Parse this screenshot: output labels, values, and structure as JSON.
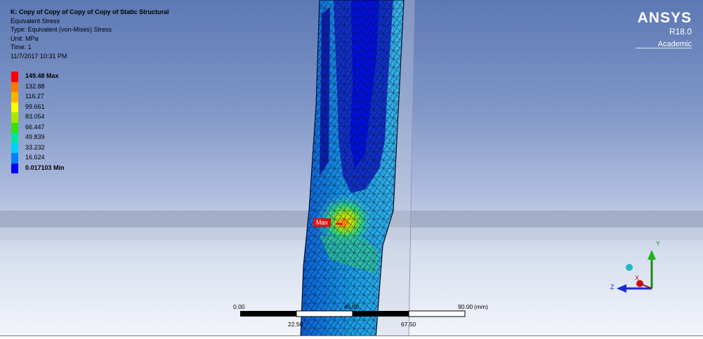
{
  "result_info": {
    "title": "K: Copy of Copy of Copy of Copy of Static Structural",
    "result": "Equivalent Stress",
    "type": "Type: Equivalent (von-Mises) Stress",
    "unit": "Unit: MPa",
    "time": "Time: 1",
    "date": "11/7/2017 10:31 PM"
  },
  "legend": {
    "entries": [
      {
        "label": "149.48 Max",
        "color": "#ff0000",
        "bold": true
      },
      {
        "label": "132.88",
        "color": "#ff7a00",
        "bold": false
      },
      {
        "label": "116.27",
        "color": "#ffb300",
        "bold": false
      },
      {
        "label": "99.661",
        "color": "#ffff00",
        "bold": false
      },
      {
        "label": "83.054",
        "color": "#a8e800",
        "bold": false
      },
      {
        "label": "66.447",
        "color": "#38e000",
        "bold": false
      },
      {
        "label": "49.839",
        "color": "#00e6a0",
        "bold": false
      },
      {
        "label": "33.232",
        "color": "#00d0ff",
        "bold": false
      },
      {
        "label": "16.624",
        "color": "#0080ff",
        "bold": false
      },
      {
        "label": "0.017103 Min",
        "color": "#0000ff",
        "bold": true
      }
    ]
  },
  "brand": {
    "name": "ANSYS",
    "version": "R18.0",
    "edition": "Academic"
  },
  "probe": {
    "max_label": "Max"
  },
  "scale_bar": {
    "start": "0.00",
    "mid": "45.00",
    "end": "90.00",
    "unit": "(mm)",
    "q1": "22.50",
    "q3": "67.50"
  },
  "triad": {
    "x_label": "X",
    "y_label": "Y",
    "z_label": "Z"
  }
}
